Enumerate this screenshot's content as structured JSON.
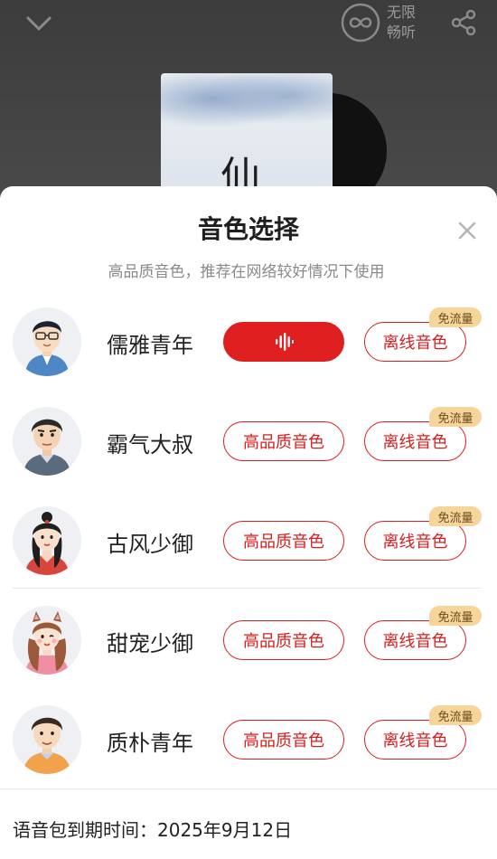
{
  "header": {
    "unlimited_line1": "无限",
    "unlimited_line2": "畅听"
  },
  "album": {
    "cover_text": "仙"
  },
  "sheet": {
    "title": "音色选择",
    "subtitle": "高品质音色，推荐在网络较好情况下使用"
  },
  "voices": [
    {
      "name": "儒雅青年",
      "hq_label": "",
      "offline_label": "离线音色",
      "badge": "免流量",
      "playing": true
    },
    {
      "name": "霸气大叔",
      "hq_label": "高品质音色",
      "offline_label": "离线音色",
      "badge": "免流量",
      "playing": false
    },
    {
      "name": "古风少御",
      "hq_label": "高品质音色",
      "offline_label": "离线音色",
      "badge": "免流量",
      "playing": false
    },
    {
      "name": "甜宠少御",
      "hq_label": "高品质音色",
      "offline_label": "离线音色",
      "badge": "免流量",
      "playing": false
    },
    {
      "name": "质朴青年",
      "hq_label": "高品质音色",
      "offline_label": "离线音色",
      "badge": "免流量",
      "playing": false
    }
  ],
  "footer": {
    "expire_label": "语音包到期时间：",
    "expire_date": "2025年9月12日"
  },
  "colors": {
    "accent": "#e02020",
    "badge_bg": "#f6d59a"
  }
}
